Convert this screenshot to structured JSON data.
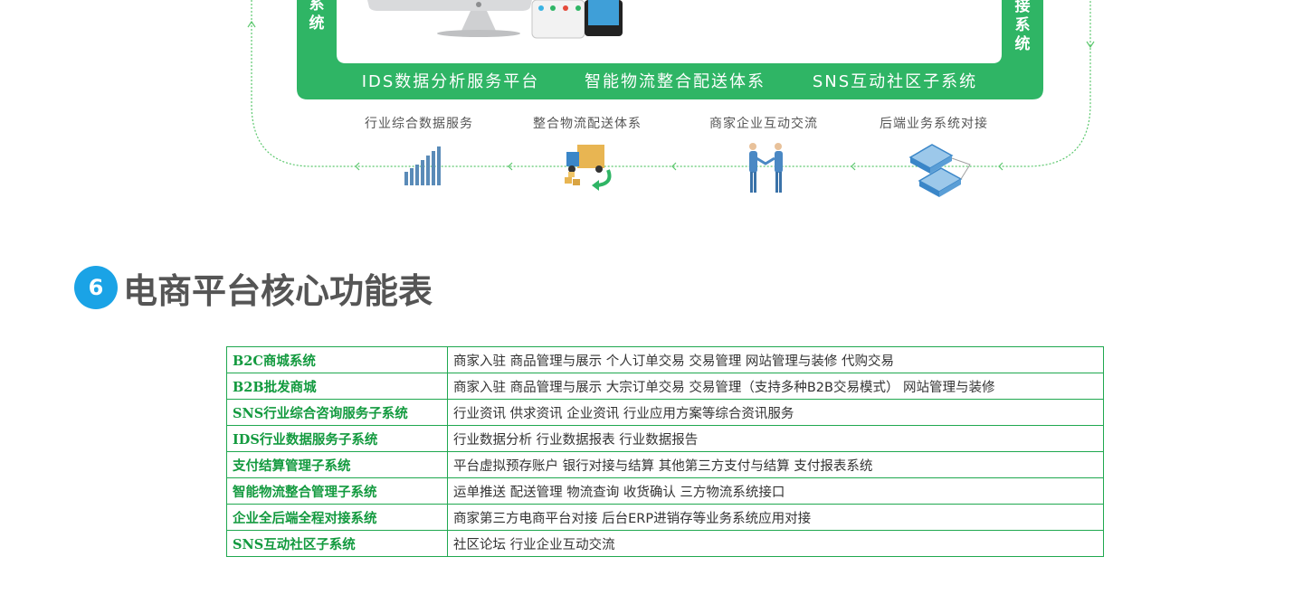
{
  "diagram": {
    "left_system_label": "系统",
    "right_system_label": "接系统",
    "platform_bar": [
      "IDS数据分析服务平台",
      "智能物流整合配送体系",
      "SNS互动社区子系统"
    ],
    "services": [
      {
        "label": "行业综合数据服务",
        "icon": "bar-chart-icon"
      },
      {
        "label": "整合物流配送体系",
        "icon": "delivery-truck-icon"
      },
      {
        "label": "商家企业互动交流",
        "icon": "handshake-icon"
      },
      {
        "label": "后端业务系统对接",
        "icon": "server-connection-icon"
      }
    ],
    "colors": {
      "green": "#2fb565",
      "flow": "#5cc86e"
    }
  },
  "section": {
    "number": "6",
    "title": "电商平台核心功能表"
  },
  "feature_table": {
    "rows": [
      {
        "name": "B2C商城系统",
        "desc": "商家入驻 商品管理与展示 个人订单交易 交易管理 网站管理与装修 代购交易"
      },
      {
        "name": "B2B批发商城",
        "desc": "商家入驻 商品管理与展示 大宗订单交易 交易管理（支持多种B2B交易模式） 网站管理与装修"
      },
      {
        "name": "SNS行业综合咨询服务子系统",
        "desc": "行业资讯 供求资讯 企业资讯 行业应用方案等综合资讯服务"
      },
      {
        "name": "IDS行业数据服务子系统",
        "desc": "行业数据分析 行业数据报表 行业数据报告"
      },
      {
        "name": "支付结算管理子系统",
        "desc": "平台虚拟预存账户 银行对接与结算 其他第三方支付与结算 支付报表系统"
      },
      {
        "name": "智能物流整合管理子系统",
        "desc": "运单推送 配送管理 物流查询 收货确认 三方物流系统接口"
      },
      {
        "name": "企业全后端全程对接系统",
        "desc": "商家第三方电商平台对接 后台ERP进销存等业务系统应用对接"
      },
      {
        "name": "SNS互动社区子系统",
        "desc": "社区论坛 行业企业互动交流"
      }
    ]
  }
}
